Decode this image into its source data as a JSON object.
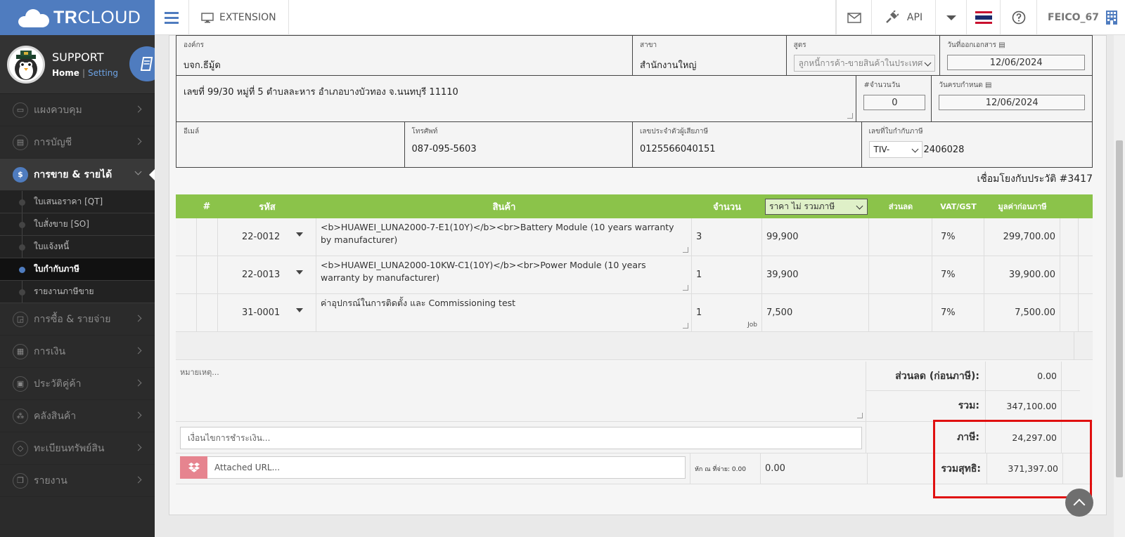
{
  "app": {
    "brand_bold": "TR",
    "brand_light": "CLOUD"
  },
  "topbar": {
    "extension_label": "EXTENSION",
    "api_label": "API",
    "username": "FEICO_67"
  },
  "profile": {
    "name": "SUPPORT",
    "home_link": "Home",
    "separator": "|",
    "setting_link": "Setting"
  },
  "sidebar": {
    "items": [
      {
        "label": "แผงควบคุม",
        "icon": "monitor-icon"
      },
      {
        "label": "การบัญชี",
        "icon": "book-icon"
      },
      {
        "label": "การขาย & รายได้",
        "icon": "dollar-icon",
        "active": true
      },
      {
        "label": "การซื้อ & รายจ่าย",
        "icon": "cart-icon"
      },
      {
        "label": "การเงิน",
        "icon": "calendar-icon"
      },
      {
        "label": "ประวัติคู่ค้า",
        "icon": "contact-icon"
      },
      {
        "label": "คลังสินค้า",
        "icon": "cubes-icon"
      },
      {
        "label": "ทะเบียนทรัพย์สิน",
        "icon": "diamond-icon"
      },
      {
        "label": "รายงาน",
        "icon": "clone-icon"
      }
    ],
    "sub_items": [
      {
        "label": "ใบเสนอราคา [QT]"
      },
      {
        "label": "ใบสั่งขาย [SO]"
      },
      {
        "label": "ใบแจ้งหนี้"
      },
      {
        "label": "ใบกำกับภาษี",
        "active": true
      },
      {
        "label": "รายงานภาษีขาย"
      }
    ]
  },
  "form": {
    "org_label": "องค์กร",
    "org_value": "บจก.ธีมู้ด",
    "branch_label": "สาขา",
    "branch_value": "สำนักงานใหญ่",
    "formula_label": "สูตร",
    "formula_value": "ลูกหนี้การค้า-ขายสินค้าในประเทศ",
    "doc_date_label": "วันที่ออกเอกสาร",
    "doc_date_value": "12/06/2024",
    "address_value": "เลขที่ 99/30 หมู่ที่ 5 ตำบลละหาร อำเภอบางบัวทอง จ.นนทบุรี 11110",
    "days_label": "#จำนวนวัน",
    "days_value": "0",
    "due_date_label": "วันครบกำหนด",
    "due_date_value": "12/06/2024",
    "email_label": "อีเมล์",
    "email_value": "",
    "phone_label": "โทรศัพท์",
    "phone_value": "087-095-5603",
    "tax_id_label": "เลขประจำตัวผู้เสียภาษี",
    "tax_id_value": "0125566040151",
    "tax_invoice_label": "เลขที่ใบกำกับภาษี",
    "tax_invoice_prefix": "TIV-",
    "tax_invoice_number": "2406028"
  },
  "history_link": "เชื่อมโยงกับประวัติ #3417",
  "table": {
    "headers": {
      "num": "#",
      "code": "รหัส",
      "product": "สินค้า",
      "qty": "จำนวน",
      "price_mode": "ราคา ไม่ รวมภาษี",
      "discount": "ส่วนลด",
      "vat": "VAT/GST",
      "amount": "มูลค่าก่อนภาษี"
    },
    "rows": [
      {
        "code": "22-0012",
        "description": "<b>HUAWEI_LUNA2000-7-E1(10Y)</b><br>Battery Module  (10 years warranty by manufacturer)",
        "qty": "3",
        "unit": "",
        "price": "99,900",
        "discount": "",
        "vat": "7%",
        "amount": "299,700.00"
      },
      {
        "code": "22-0013",
        "description": "<b>HUAWEI_LUNA2000-10KW-C1(10Y)</b><br>Power Module  (10 years warranty by manufacturer)",
        "qty": "1",
        "unit": "",
        "price": "39,900",
        "discount": "",
        "vat": "7%",
        "amount": "39,900.00"
      },
      {
        "code": "31-0001",
        "description": "ค่าอุปกรณ์ในการติดตั้ง และ Commissioning test",
        "qty": "1",
        "unit": "Job",
        "price": "7,500",
        "discount": "",
        "vat": "7%",
        "amount": "7,500.00"
      }
    ]
  },
  "footer": {
    "note_placeholder": "หมายเหตุ...",
    "condition_placeholder": "เงื่อนไขการชำระเงิน...",
    "url_placeholder": "Attached URL...",
    "withholding_label": "หัก ณ ที่จ่าย: 0.00",
    "withholding_value": "0.00",
    "discount_label": "ส่วนลด (ก่อนภาษี):",
    "discount_value": "0.00",
    "total_label": "รวม:",
    "total_value": "347,100.00",
    "tax_label": "ภาษี:",
    "tax_value": "24,297.00",
    "net_label": "รวมสุทธิ:",
    "net_value": "371,397.00"
  },
  "colors": {
    "brand": "#4f7cbf",
    "table_header": "#8bc34a",
    "highlight": "#e01010",
    "sidebar": "#2b2b2b"
  }
}
